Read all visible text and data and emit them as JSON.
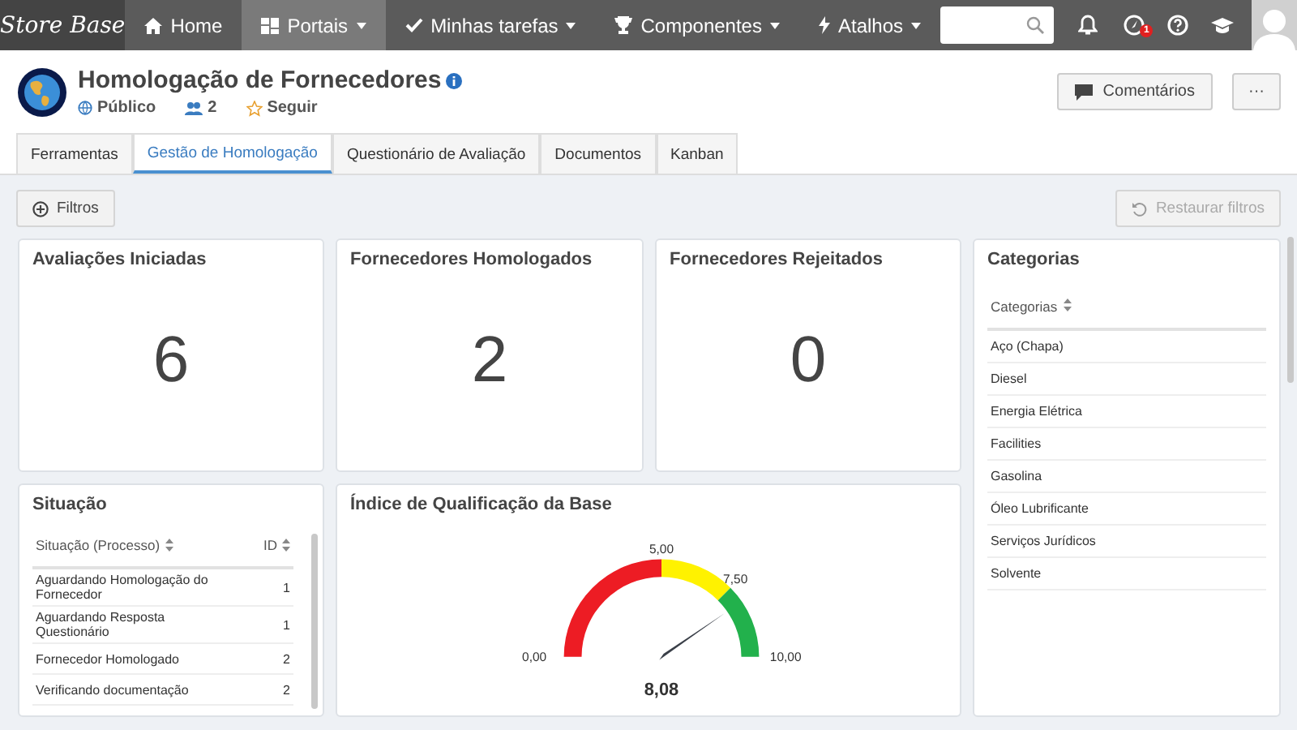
{
  "topbar": {
    "logo": "Store Base",
    "nav": [
      {
        "label": "Home",
        "selected": false,
        "caret": false
      },
      {
        "label": "Portais",
        "selected": true,
        "caret": true
      },
      {
        "label": "Minhas tarefas",
        "selected": false,
        "caret": true
      },
      {
        "label": "Componentes",
        "selected": false,
        "caret": true
      },
      {
        "label": "Atalhos",
        "selected": false,
        "caret": true
      }
    ],
    "notification_badge": "1"
  },
  "header": {
    "title": "Homologação de Fornecedores",
    "visibility": "Público",
    "members": "2",
    "follow": "Seguir",
    "buttons": [
      "Comentários",
      "···"
    ]
  },
  "tabs": [
    {
      "label": "Ferramentas",
      "selected": false
    },
    {
      "label": "Gestão de Homologação",
      "selected": true
    },
    {
      "label": "Questionário de Avaliação",
      "selected": false
    },
    {
      "label": "Documentos",
      "selected": false
    },
    {
      "label": "Kanban",
      "selected": false
    }
  ],
  "toolbar": {
    "filters": "Filtros",
    "reset": "Restaurar filtros",
    "reset_disabled": true
  },
  "kpis": [
    {
      "title": "Avaliações Iniciadas",
      "value": "6"
    },
    {
      "title": "Fornecedores Homologados",
      "value": "2"
    },
    {
      "title": "Fornecedores Rejeitados",
      "value": "0"
    }
  ],
  "categories": {
    "title": "Categorias",
    "column": "Categorias",
    "rows": [
      "Aço (Chapa)",
      "Diesel",
      "Energia Elétrica",
      "Facilities",
      "Gasolina",
      "Óleo Lubrificante",
      "Serviços Jurídicos",
      "Solvente"
    ]
  },
  "status": {
    "title": "Situação",
    "columns": [
      "Situação (Processo)",
      "ID"
    ],
    "rows": [
      [
        "Aguardando Homologação do Fornecedor",
        "1"
      ],
      [
        "Aguardando Resposta Questionário",
        "1"
      ],
      [
        "Fornecedor Homologado",
        "2"
      ],
      [
        "Verificando documentação",
        "2"
      ]
    ]
  },
  "gauge": {
    "title": "Índice de Qualificação da Base",
    "value": "8,08",
    "ticks": [
      "0,00",
      "5,00",
      "7,50",
      "10,00"
    ]
  }
}
